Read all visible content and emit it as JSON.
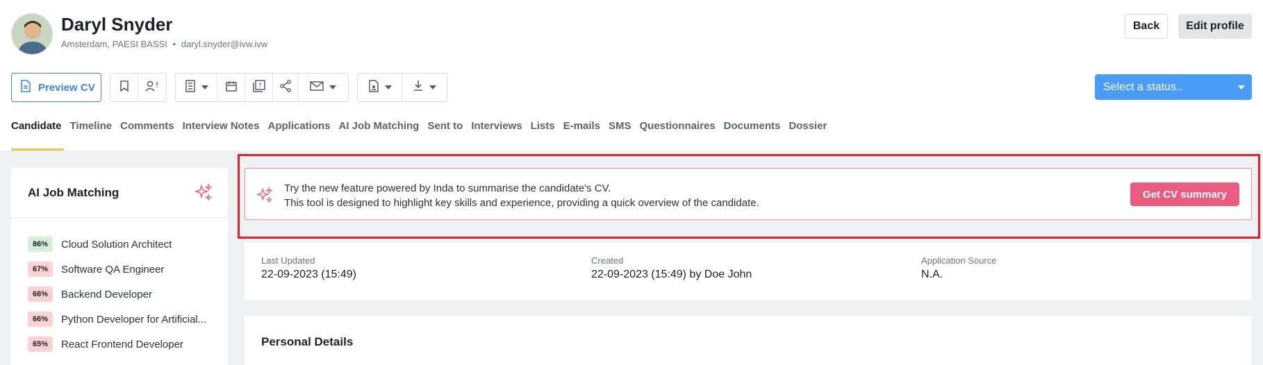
{
  "profile": {
    "name": "Daryl Snyder",
    "location": "Amsterdam, PAESI BASSI",
    "email": "daryl.snyder@ivw.ivw"
  },
  "header": {
    "back_label": "Back",
    "edit_label": "Edit profile"
  },
  "toolbar": {
    "preview_label": "Preview CV",
    "status_placeholder": "Select a status..",
    "icons": [
      "bookmark-icon",
      "person-alert-icon",
      "notes-icon",
      "calendar-icon",
      "question-doc-icon",
      "share-icon",
      "mail-icon",
      "document-icon",
      "download-icon"
    ]
  },
  "tabs": [
    "Candidate",
    "Timeline",
    "Comments",
    "Interview Notes",
    "Applications",
    "AI Job Matching",
    "Sent to",
    "Interviews",
    "Lists",
    "E-mails",
    "SMS",
    "Questionnaires",
    "Documents",
    "Dossier"
  ],
  "ai_job_matching": {
    "title": "AI Job Matching",
    "items": [
      {
        "score": "86%",
        "title": "Cloud Solution Architect",
        "level": "green"
      },
      {
        "score": "67%",
        "title": "Software QA Engineer",
        "level": "red"
      },
      {
        "score": "66%",
        "title": "Backend Developer",
        "level": "red"
      },
      {
        "score": "66%",
        "title": "Python Developer for Artificial...",
        "level": "red"
      },
      {
        "score": "65%",
        "title": "React Frontend Developer",
        "level": "red"
      }
    ]
  },
  "banner": {
    "line1": "Try the new feature powered by Inda to summarise the candidate's CV.",
    "line2": "This tool is designed to highlight key skills and experience, providing a quick overview of the candidate.",
    "button": "Get CV summary"
  },
  "meta": {
    "last_updated_label": "Last Updated",
    "last_updated_value": "22-09-2023 (15:49)",
    "created_label": "Created",
    "created_value": "22-09-2023 (15:49) by Doe John",
    "source_label": "Application Source",
    "source_value": "N.A."
  },
  "personal_details": {
    "title": "Personal Details"
  },
  "colors": {
    "accent": "#3b82f6",
    "status": "#4b9cf5",
    "summary": "#ea5b80",
    "highlight": "#e5202b",
    "tab_underline": "#f5c542"
  }
}
